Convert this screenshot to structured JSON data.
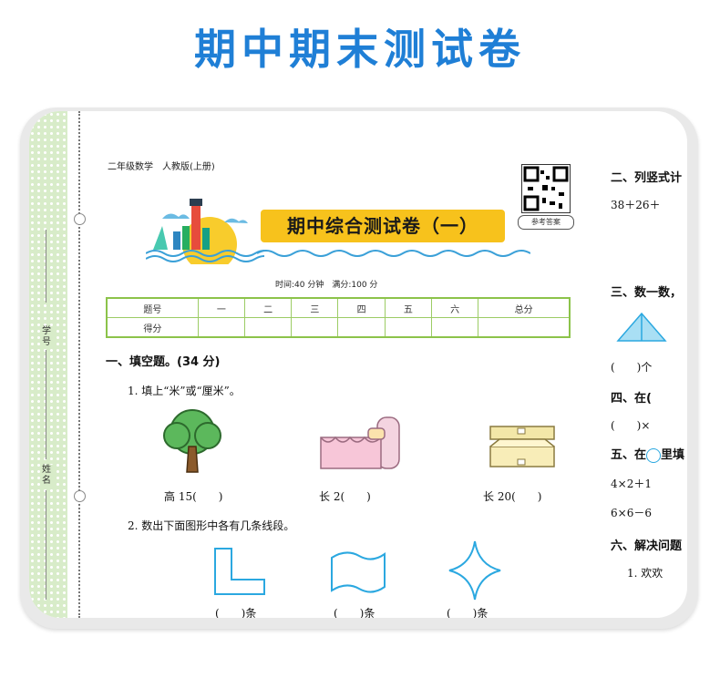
{
  "headline": "期中期末测试卷",
  "spine": {
    "student_id_label": "学号",
    "name_label": "姓名"
  },
  "paper": {
    "subject_line": "二年级数学　人教版(上册)",
    "title": "期中综合测试卷（一）",
    "qr_label": "参考答案",
    "time_line": "时间:40 分钟　满分:100 分",
    "score_table": {
      "header": [
        "题号",
        "一",
        "二",
        "三",
        "四",
        "五",
        "六",
        "总分"
      ],
      "row_label": "得分"
    },
    "section1": {
      "title": "一、填空题。(34 分)",
      "q1": "1. 填上“米”或“厘米”。",
      "captions": [
        "高 15(　　)",
        "长 2(　　)",
        "长 20(　　)"
      ],
      "q2": "2. 数出下面图形中各有几条线段。",
      "answers": [
        "(　　)条",
        "(　　)条",
        "(　　)条"
      ]
    },
    "right": {
      "s2": "二、列竖式计",
      "s2_line": "38＋26＋",
      "s3": "三、数一数，",
      "s3_ans": "(　　)个",
      "s4": "四、在(",
      "s4_ans": "(　　)×",
      "s5": "五、在",
      "s5_tail": "里填",
      "s5_l1": "4×2＋1",
      "s5_l2": "6×6－6",
      "s6": "六、解决问题",
      "s6_q1": "1. 欢欢"
    }
  }
}
